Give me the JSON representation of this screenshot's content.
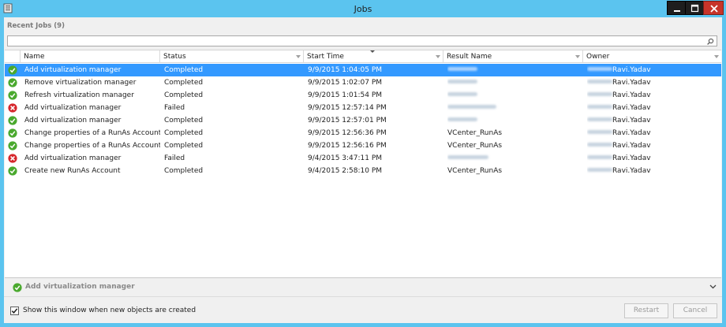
{
  "window": {
    "title": "Jobs"
  },
  "jobs_panel": {
    "heading": "Recent Jobs (9)",
    "search_value": ""
  },
  "columns": {
    "name": "Name",
    "status": "Status",
    "start_time": "Start Time",
    "result_name": "Result Name",
    "owner": "Owner"
  },
  "rows": [
    {
      "name": "Add virtualization manager",
      "status": "Completed",
      "start_time": "9/9/2015 1:04:05 PM",
      "result_name": "",
      "owner": "Ravi.Yadav",
      "result_state": "success",
      "selected": true
    },
    {
      "name": "Remove virtualization manager",
      "status": "Completed",
      "start_time": "9/9/2015 1:02:07 PM",
      "result_name": "",
      "owner": "Ravi.Yadav",
      "result_state": "success",
      "selected": false
    },
    {
      "name": "Refresh virtualization manager",
      "status": "Completed",
      "start_time": "9/9/2015 1:01:54 PM",
      "result_name": "",
      "owner": "Ravi.Yadav",
      "result_state": "success",
      "selected": false
    },
    {
      "name": "Add virtualization manager",
      "status": "Failed",
      "start_time": "9/9/2015 12:57:14 PM",
      "result_name": "",
      "owner": "Ravi.Yadav",
      "result_state": "failed",
      "selected": false
    },
    {
      "name": "Add virtualization manager",
      "status": "Completed",
      "start_time": "9/9/2015 12:57:01 PM",
      "result_name": "",
      "owner": "Ravi.Yadav",
      "result_state": "success",
      "selected": false
    },
    {
      "name": "Change properties of a RunAs Account",
      "status": "Completed",
      "start_time": "9/9/2015 12:56:36 PM",
      "result_name": "VCenter_RunAs",
      "owner": "Ravi.Yadav",
      "result_state": "success",
      "selected": false
    },
    {
      "name": "Change properties of a RunAs Account",
      "status": "Completed",
      "start_time": "9/9/2015 12:56:16 PM",
      "result_name": "VCenter_RunAs",
      "owner": "Ravi.Yadav",
      "result_state": "success",
      "selected": false
    },
    {
      "name": "Add virtualization manager",
      "status": "Failed",
      "start_time": "9/4/2015 3:47:11 PM",
      "result_name": "",
      "owner": "Ravi.Yadav",
      "result_state": "failed",
      "selected": false
    },
    {
      "name": "Create new RunAs Account",
      "status": "Completed",
      "start_time": "9/4/2015 2:58:10 PM",
      "result_name": "VCenter_RunAs",
      "owner": "Ravi.Yadav",
      "result_state": "success",
      "selected": false
    }
  ],
  "detail": {
    "job_name": "Add virtualization manager",
    "icon": "success-check-icon"
  },
  "footer": {
    "checkbox_label": "Show this window when new objects are created",
    "checkbox_checked": true,
    "restart_label": "Restart",
    "cancel_label": "Cancel"
  },
  "icons": {
    "success": "success-check-icon",
    "failed": "failed-x-icon",
    "search": "search-icon",
    "expand": "chevron-down-icon"
  },
  "colors": {
    "titlebar": "#5bc4ef",
    "selection": "#3399ff",
    "success": "#4aa92e",
    "failed": "#d6262b",
    "close_button": "#c7342a"
  }
}
